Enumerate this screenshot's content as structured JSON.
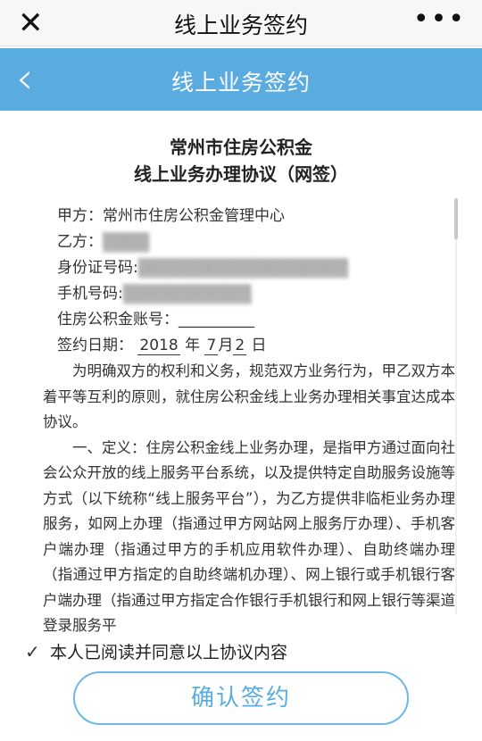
{
  "topbar": {
    "title": "线上业务签约",
    "close_icon": "✕",
    "more_icon": "•••"
  },
  "navbar": {
    "title": "线上业务签约",
    "back_icon": "‹"
  },
  "document": {
    "title_line1": "常州市住房公积金",
    "title_line2": "线上业务办理协议（网签）",
    "party_a_label": "甲方：",
    "party_a_value": "常州市住房公积金管理中心",
    "party_b_label": "乙方：",
    "party_b_value": "▒▒▒▒",
    "id_label": "身份证号码:",
    "id_value": "▒▒▒▒▒▒▒▒▒▒▒▒▒▒▒▒▒▒",
    "phone_label": "手机号码:",
    "phone_value": "▒▒▒▒▒▒▒▒▒▒▒",
    "account_label": "住房公积金账号：",
    "account_value": "__________",
    "sign_date_label": "签约日期：",
    "sign_year": "2018",
    "year_unit": "年",
    "sign_month": "7",
    "month_unit": "月",
    "sign_day": "2",
    "day_unit": "日",
    "para1": "为明确双方的权利和义务，规范双方业务行为，甲乙双方本着平等互利的原则，就住房公积金线上业务办理相关事宜达成本协议。",
    "para2": "一、定义：住房公积金线上业务办理，是指甲方通过面向社会公众开放的线上服务平台系统，以及提供特定自助服务设施等方式（以下统称“线上服务平台”），为乙方提供非临柜业务办理服务，如网上办理（指通过甲方网站网上服务厅办理）、手机客户端办理（指通过甲方的手机应用软件办理）、自助终端办理（指通过甲方指定的自助终端机办理）、网上银行或手机银行客户端办理（指通过甲方指定合作银行手机银行和网上银行等渠道登录服务平"
  },
  "agreement": {
    "check_icon": "✓",
    "text": "本人已阅读并同意以上协议内容"
  },
  "confirm_button": {
    "label": "确认签约"
  },
  "colors": {
    "nav_bg": "#5aace0",
    "button_border": "#6cb8e6"
  }
}
